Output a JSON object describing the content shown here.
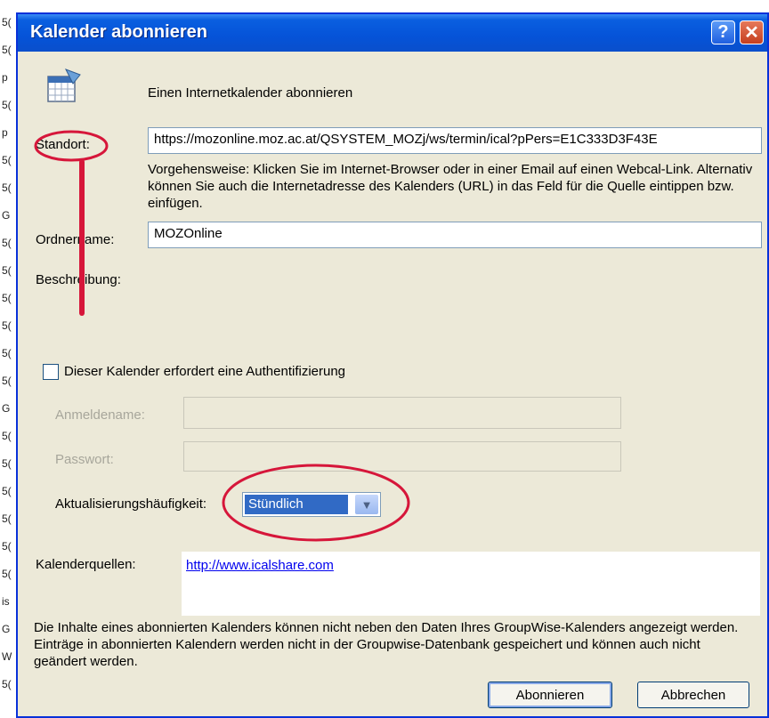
{
  "background_list": {
    "items": [
      "5(",
      "5(",
      "p",
      "5(",
      "p",
      "5(",
      "5(",
      "G",
      "5(",
      "5(",
      "5(",
      "5(",
      "5(",
      "5(",
      "G",
      "5(",
      "5(",
      "5(",
      "5(",
      "5(",
      "5(",
      "is",
      "G",
      "W",
      "5("
    ]
  },
  "window": {
    "title": "Kalender abonnieren",
    "help_label": "?",
    "close_label": "✕"
  },
  "header": {
    "icon": "calendar-subscribe-icon",
    "text": "Einen Internetkalender abonnieren"
  },
  "form": {
    "location_label": "Standort:",
    "location_value": "https://mozonline.moz.ac.at/QSYSTEM_MOZj/ws/termin/ical?pPers=E1C333D3F43E",
    "instructions": "Vorgehensweise: Klicken Sie im Internet-Browser oder in einer Email auf einen Webcal-Link. Alternativ können Sie auch die Internetadresse des Kalenders (URL) in das Feld für die Quelle eintippen bzw. einfügen.",
    "folder_label": "Ordnername:",
    "folder_value": "MOZOnline",
    "description_label": "Beschreibung:",
    "auth_checkbox_label": "Dieser Kalender erfordert eine Authentifizierung",
    "auth_checked": false,
    "username_label": "Anmeldename:",
    "password_label": "Passwort:",
    "frequency_label": "Aktualisierungshäufigkeit:",
    "frequency_value": "Stündlich",
    "sources_label": "Kalenderquellen:",
    "sources_link": "http://www.icalshare.com"
  },
  "footer": {
    "note": "Die Inhalte eines abonnierten Kalenders können nicht neben den Daten Ihres GroupWise-Kalenders angezeigt werden. Einträge in abonnierten Kalendern werden nicht in der Groupwise-Datenbank gespeichert und können auch nicht geändert werden.",
    "subscribe_label": "Abonnieren",
    "cancel_label": "Abbrechen"
  },
  "colors": {
    "annotation": "#d6163a",
    "titlebar": "#0553d8",
    "dialog_bg": "#ece9d8",
    "selection": "#316ac5"
  }
}
